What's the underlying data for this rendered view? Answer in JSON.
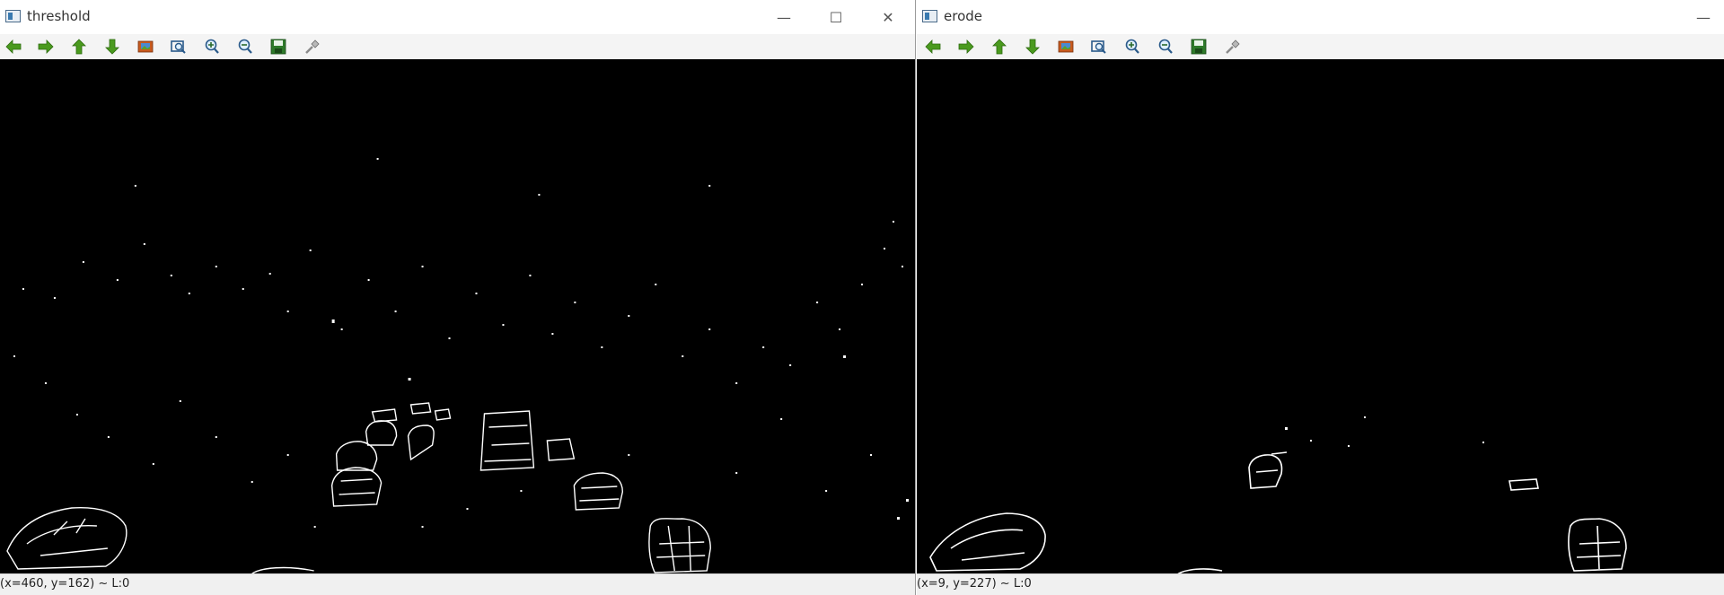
{
  "windows": {
    "threshold": {
      "title": "threshold",
      "status": "(x=460, y=162) ~ L:0",
      "controls": {
        "minimize": "—",
        "maximize": "☐",
        "close": "✕"
      }
    },
    "erode": {
      "title": "erode",
      "status": "(x=9, y=227) ~ L:0",
      "controls": {
        "minimize": "—"
      }
    }
  },
  "toolbar": {
    "buttons": [
      {
        "icon": "arrow-left-icon",
        "tooltip": "Panning left"
      },
      {
        "icon": "arrow-right-icon",
        "tooltip": "Panning right"
      },
      {
        "icon": "arrow-up-icon",
        "tooltip": "Panning up"
      },
      {
        "icon": "arrow-down-icon",
        "tooltip": "Panning down"
      },
      {
        "icon": "zoom-original-icon",
        "tooltip": "Zoom x1"
      },
      {
        "icon": "zoom-fit-icon",
        "tooltip": "Adjust size"
      },
      {
        "icon": "zoom-in-icon",
        "tooltip": "Zoom in"
      },
      {
        "icon": "zoom-out-icon",
        "tooltip": "Zoom out"
      },
      {
        "icon": "save-icon",
        "tooltip": "Save"
      },
      {
        "icon": "properties-icon",
        "tooltip": "Display properties window"
      }
    ]
  },
  "colors": {
    "arrow_green": "#4a9a1e",
    "image_background": "#000000",
    "foreground": "#ffffff"
  }
}
